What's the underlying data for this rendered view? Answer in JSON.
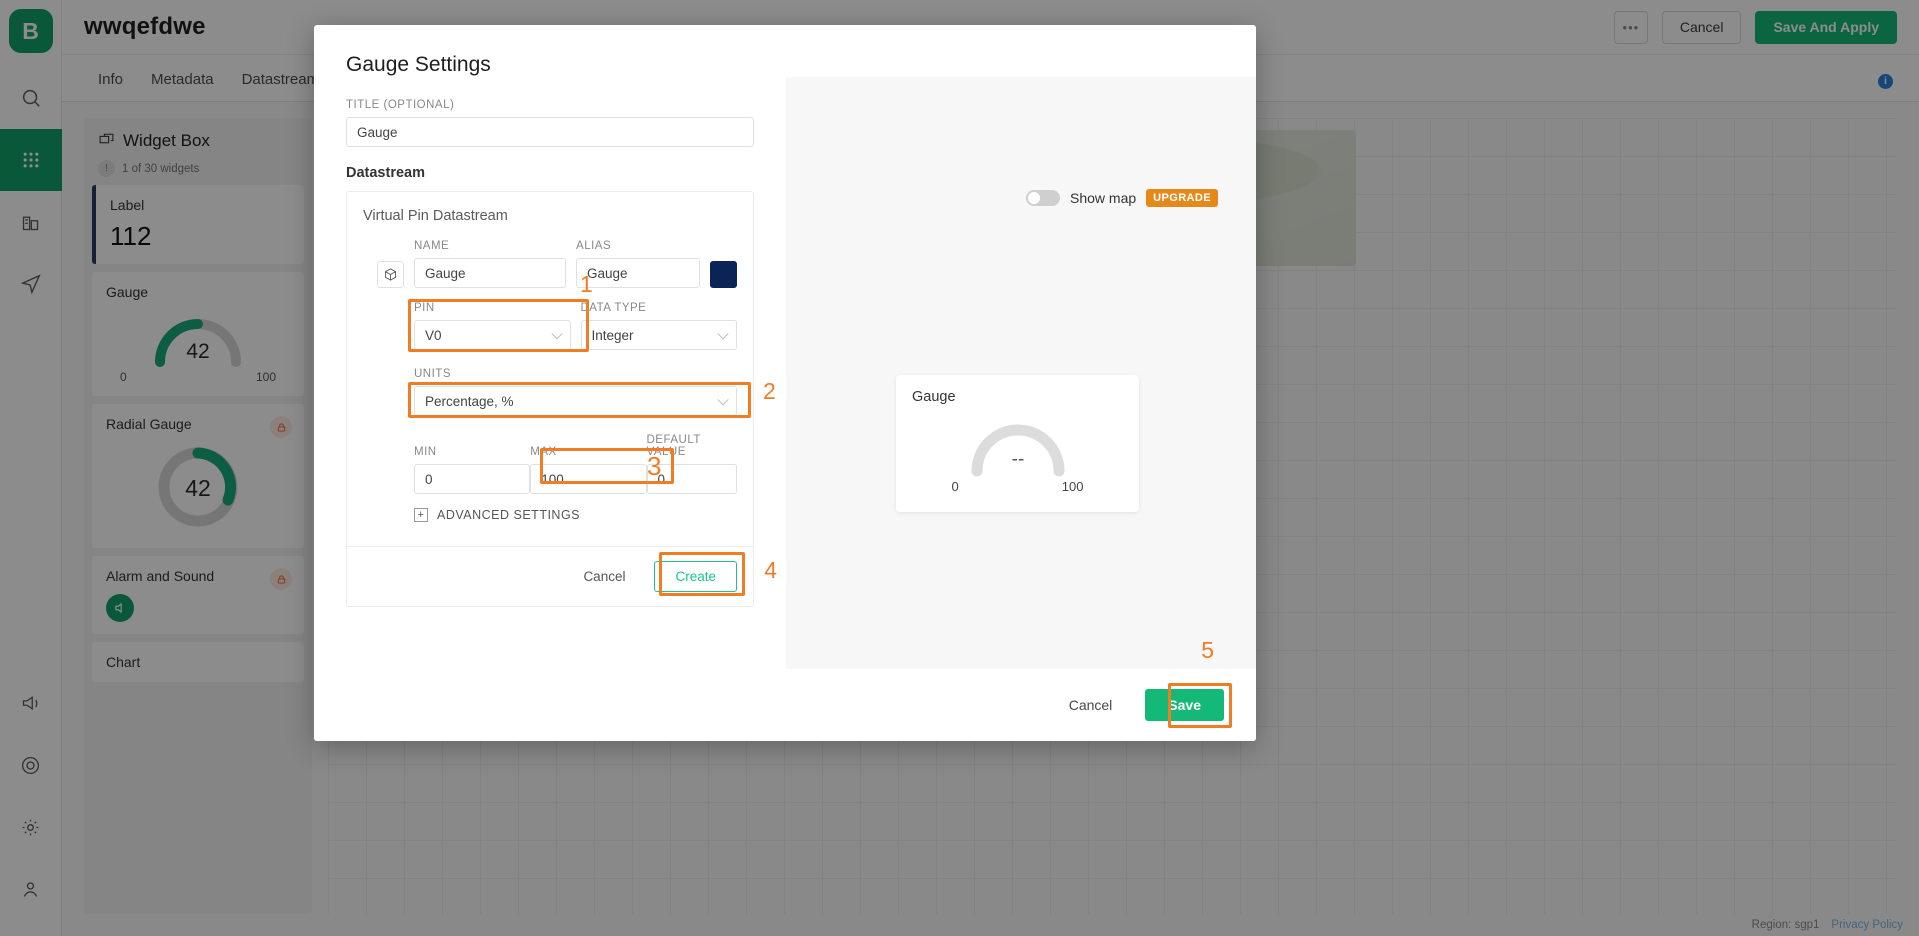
{
  "rail": {
    "logo_text": "B",
    "items": [
      {
        "name": "search-icon",
        "label": "Search"
      },
      {
        "name": "apps-grid-icon",
        "label": "Devices"
      },
      {
        "name": "organization-icon",
        "label": "Organization"
      },
      {
        "name": "automations-icon",
        "label": "Automations"
      },
      {
        "name": "announcements-icon",
        "label": "Announcements"
      },
      {
        "name": "support-icon",
        "label": "Support"
      },
      {
        "name": "settings-gear-icon",
        "label": "Settings"
      },
      {
        "name": "user-account-icon",
        "label": "Account"
      }
    ]
  },
  "topbar": {
    "device_title": "wwqefdwe",
    "more_label": "•••",
    "cancel_label": "Cancel",
    "save_apply_label": "Save And Apply"
  },
  "tabs": [
    {
      "label": "Info",
      "active": false
    },
    {
      "label": "Metadata",
      "active": false
    },
    {
      "label": "Datastream",
      "active": false
    }
  ],
  "widget_box": {
    "title": "Widget Box",
    "counter": "1 of 30 widgets",
    "badge": "!",
    "items": [
      {
        "label": "Label",
        "value": "112",
        "type": "label"
      },
      {
        "label": "Gauge",
        "value": "42",
        "min": "0",
        "max": "100",
        "type": "gauge"
      },
      {
        "label": "Radial Gauge",
        "value": "42",
        "type": "radial",
        "locked": true
      },
      {
        "label": "Alarm and Sound",
        "type": "sound",
        "locked": true
      },
      {
        "label": "Chart",
        "type": "plain"
      }
    ]
  },
  "canvas": {
    "map_widget": {
      "toggle_label": "Show map",
      "upgrade_label": "UPGRADE"
    }
  },
  "statusbar": {
    "region": "Region: sgp1",
    "privacy": "Privacy Policy"
  },
  "modal": {
    "title": "Gauge Settings",
    "title_field": {
      "label": "TITLE (OPTIONAL)",
      "value": "Gauge",
      "placeholder": "Gauge"
    },
    "datastream_section_label": "Datastream",
    "card": {
      "heading": "Virtual Pin Datastream",
      "name_label": "NAME",
      "name_value": "Gauge",
      "alias_label": "ALIAS",
      "alias_value": "Gauge",
      "color_hex": "#0a2458",
      "cube_icon": "cube-icon",
      "pin_label": "PIN",
      "pin_value": "V0",
      "data_type_label": "DATA TYPE",
      "data_type_value": "Integer",
      "units_label": "UNITS",
      "units_value": "Percentage, %",
      "min_label": "MIN",
      "min_value": "0",
      "max_label": "MAX",
      "max_value": "100",
      "default_label": "DEFAULT VALUE",
      "default_value": "0",
      "advanced_label": "ADVANCED SETTINGS",
      "advanced_plus": "+",
      "cancel_label": "Cancel",
      "create_label": "Create"
    },
    "preview": {
      "title": "Gauge",
      "value": "--",
      "min": "0",
      "max": "100"
    },
    "footer": {
      "cancel_label": "Cancel",
      "save_label": "Save"
    }
  },
  "annotations": {
    "highlight_color": "#f07c24",
    "markers": [
      {
        "number": "1",
        "target": "pin-field"
      },
      {
        "number": "2",
        "target": "units-field"
      },
      {
        "number": "3",
        "target": "max-field"
      },
      {
        "number": "4",
        "target": "create-button"
      },
      {
        "number": "5",
        "target": "save-button"
      }
    ]
  }
}
